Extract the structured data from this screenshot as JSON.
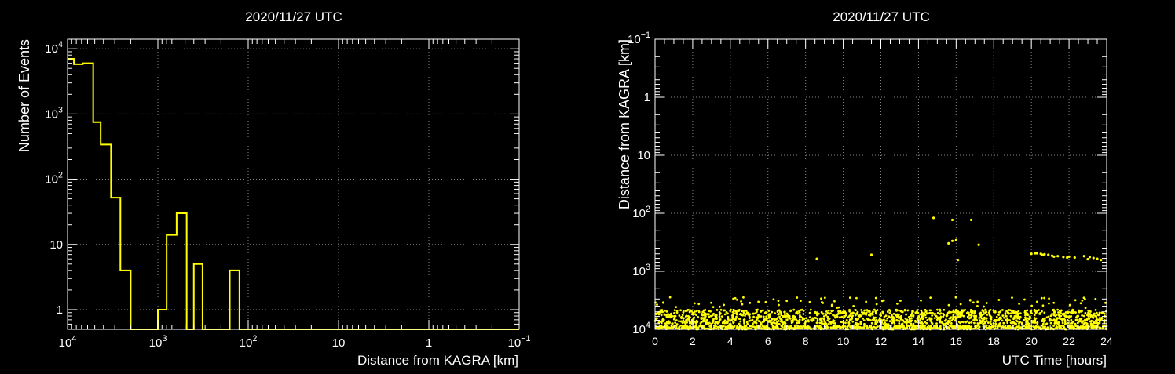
{
  "colors": {
    "background": "#000000",
    "axis": "#ffffff",
    "grid": "#888888",
    "series": "#ffff00"
  },
  "chart_data": [
    {
      "type": "histogram",
      "title": "2020/11/27 UTC",
      "xlabel": "Distance from KAGRA [km]",
      "ylabel": "Number of Events",
      "x_scale": "log",
      "x_reversed": true,
      "y_scale": "log",
      "xlim": [
        10000,
        0.1
      ],
      "ylim": [
        0.5,
        14000
      ],
      "grid": true,
      "x_ticks": [
        {
          "value": 10000,
          "base": "10",
          "exp": "4"
        },
        {
          "value": 1000,
          "base": "10",
          "exp": "3"
        },
        {
          "value": 100,
          "base": "10",
          "exp": "2"
        },
        {
          "value": 10,
          "base": "10",
          "exp": ""
        },
        {
          "value": 1,
          "base": "1",
          "exp": ""
        },
        {
          "value": 0.1,
          "base": "10",
          "exp": "−1"
        }
      ],
      "y_ticks": [
        {
          "value": 1,
          "base": "1",
          "exp": ""
        },
        {
          "value": 10,
          "base": "10",
          "exp": ""
        },
        {
          "value": 100,
          "base": "10",
          "exp": "2"
        },
        {
          "value": 1000,
          "base": "10",
          "exp": "3"
        },
        {
          "value": 10000,
          "base": "10",
          "exp": "4"
        }
      ],
      "bins": [
        {
          "from": 10000,
          "to": 8500,
          "count": 7000
        },
        {
          "from": 8500,
          "to": 6800,
          "count": 5800
        },
        {
          "from": 6800,
          "to": 5200,
          "count": 6000
        },
        {
          "from": 5200,
          "to": 4300,
          "count": 750
        },
        {
          "from": 4300,
          "to": 3300,
          "count": 340
        },
        {
          "from": 3300,
          "to": 2600,
          "count": 52
        },
        {
          "from": 2600,
          "to": 2000,
          "count": 4
        },
        {
          "from": 2000,
          "to": 1000,
          "count": 0
        },
        {
          "from": 1000,
          "to": 800,
          "count": 1
        },
        {
          "from": 800,
          "to": 620,
          "count": 14
        },
        {
          "from": 620,
          "to": 480,
          "count": 30
        },
        {
          "from": 480,
          "to": 400,
          "count": 0
        },
        {
          "from": 400,
          "to": 320,
          "count": 5
        },
        {
          "from": 320,
          "to": 160,
          "count": 0
        },
        {
          "from": 160,
          "to": 125,
          "count": 4
        },
        {
          "from": 125,
          "to": 0.1,
          "count": 0
        }
      ]
    },
    {
      "type": "scatter",
      "title": "2020/11/27 UTC",
      "xlabel": "UTC Time [hours]",
      "ylabel": "Distance from KAGRA [km]",
      "x_scale": "linear",
      "y_scale": "log",
      "y_reversed": true,
      "xlim": [
        0,
        24
      ],
      "ylim": [
        0.1,
        10000
      ],
      "grid": true,
      "x_ticks": [
        0,
        2,
        4,
        6,
        8,
        10,
        12,
        14,
        16,
        18,
        20,
        22,
        24
      ],
      "y_ticks": [
        {
          "value": 0.1,
          "base": "10",
          "exp": "−1"
        },
        {
          "value": 1,
          "base": "1",
          "exp": ""
        },
        {
          "value": 10,
          "base": "10",
          "exp": ""
        },
        {
          "value": 100,
          "base": "10",
          "exp": "2"
        },
        {
          "value": 1000,
          "base": "10",
          "exp": "3"
        },
        {
          "value": 10000,
          "base": "10",
          "exp": "4"
        }
      ],
      "bands": [
        {
          "d_min": 4600,
          "d_max": 6400,
          "n": 700,
          "x_min": 0,
          "x_max": 24
        },
        {
          "d_min": 6400,
          "d_max": 8200,
          "n": 600,
          "x_min": 0,
          "x_max": 24
        },
        {
          "d_min": 8600,
          "d_max": 10000,
          "n": 800,
          "x_min": 0,
          "x_max": 24
        },
        {
          "d_min": 2800,
          "d_max": 4300,
          "n": 80,
          "x_min": 0,
          "x_max": 24
        }
      ],
      "points": [
        [
          8.6,
          610
        ],
        [
          11.5,
          520
        ],
        [
          14.8,
          120
        ],
        [
          15.8,
          130
        ],
        [
          16.8,
          130
        ],
        [
          15.6,
          330
        ],
        [
          15.8,
          300
        ],
        [
          16.0,
          290
        ],
        [
          16.1,
          640
        ],
        [
          17.2,
          350
        ],
        [
          20.0,
          500
        ],
        [
          20.3,
          490
        ],
        [
          20.5,
          500
        ],
        [
          20.7,
          510
        ],
        [
          20.9,
          520
        ],
        [
          21.1,
          540
        ],
        [
          21.4,
          550
        ],
        [
          21.7,
          570
        ],
        [
          22.0,
          560
        ],
        [
          22.3,
          580
        ],
        [
          22.8,
          550
        ],
        [
          23.1,
          570
        ],
        [
          23.3,
          590
        ],
        [
          23.5,
          610
        ],
        [
          23.7,
          640
        ],
        [
          23.0,
          620
        ],
        [
          21.9,
          580
        ],
        [
          20.2,
          490
        ],
        [
          20.6,
          520
        ],
        [
          21.2,
          560
        ]
      ]
    }
  ]
}
